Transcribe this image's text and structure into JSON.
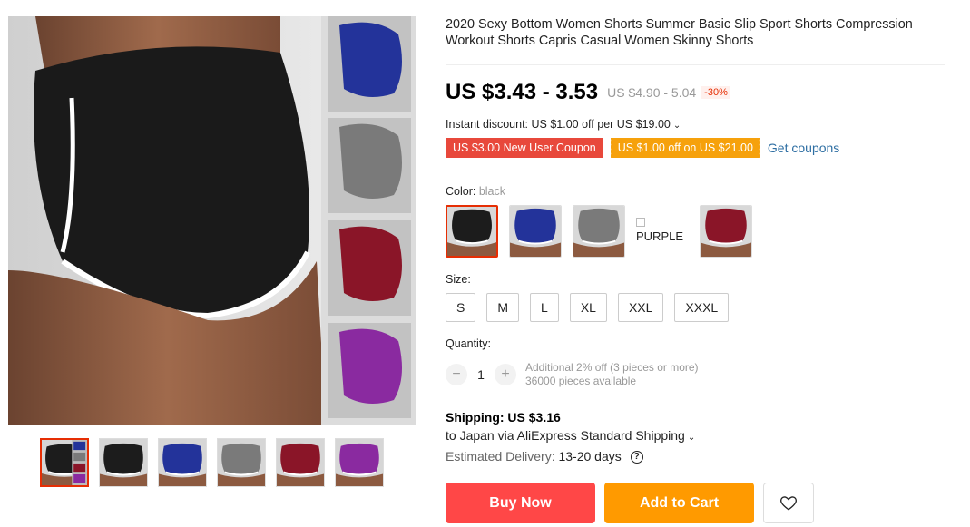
{
  "product": {
    "title": "2020 Sexy Bottom Women Shorts Summer Basic Slip Sport Shorts Compression Workout Shorts Capris Casual Women Skinny Shorts"
  },
  "price": {
    "current": "US $3.43 - 3.53",
    "original": "US $4.90 - 5.04",
    "discount": "-30%"
  },
  "instant_discount": {
    "text": "Instant discount: US $1.00 off per US $19.00",
    "chevron_icon": "chevron-down-icon"
  },
  "coupons": {
    "items": [
      "US $3.00 New User Coupon",
      "US $1.00 off on US $21.00"
    ],
    "link": "Get coupons"
  },
  "color": {
    "label": "Color:",
    "selected": "black",
    "options": [
      {
        "name": "black",
        "color": "#1c1c1c"
      },
      {
        "name": "blue",
        "color": "#23339a"
      },
      {
        "name": "gray",
        "color": "#7a7a7a"
      },
      {
        "name": "PURPLE",
        "color": "#8a2aa0",
        "broken_alt": "PURPLE"
      },
      {
        "name": "wine red",
        "color": "#8a1528"
      }
    ]
  },
  "size": {
    "label": "Size:",
    "options": [
      "S",
      "M",
      "L",
      "XL",
      "XXL",
      "XXXL"
    ]
  },
  "quantity": {
    "label": "Quantity:",
    "value": "1",
    "minus": "−",
    "plus": "+",
    "note1": "Additional 2% off (3 pieces or more)",
    "note2": "36000 pieces available"
  },
  "shipping": {
    "title": "Shipping: US $3.16",
    "via": "to Japan via AliExpress Standard Shipping",
    "delivery_label": "Estimated Delivery:",
    "delivery_value": "13-20 days",
    "help_icon": "question-circle-icon"
  },
  "actions": {
    "buy_now": "Buy Now",
    "add_to_cart": "Add to Cart",
    "wishlist_icon": "heart-icon"
  },
  "gallery": {
    "thumb_colors": [
      "#1c1c1c",
      "#1c1c1c",
      "#23339a",
      "#7a7a7a",
      "#8a1528",
      "#8a2aa0"
    ]
  }
}
